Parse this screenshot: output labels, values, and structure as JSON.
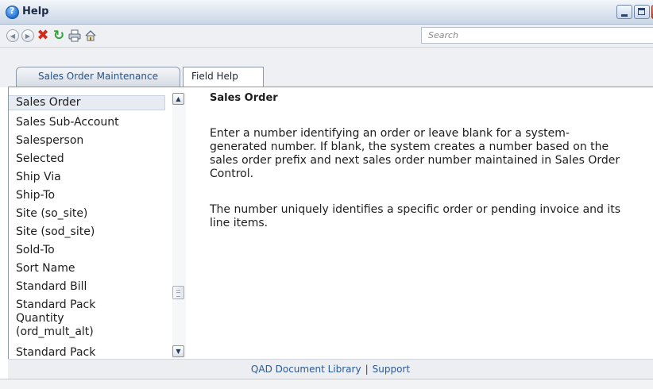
{
  "window": {
    "title": "Help"
  },
  "toolbar": {
    "icons": [
      "back-icon",
      "forward-icon",
      "stop-icon",
      "refresh-icon",
      "print-icon",
      "home-icon"
    ],
    "search_placeholder": "Search"
  },
  "tabs": [
    {
      "label": "Sales Order Maintenance",
      "active": false
    },
    {
      "label": "Field Help",
      "active": true
    }
  ],
  "list": {
    "items": [
      {
        "label": "Sales Order",
        "selected": true
      },
      {
        "label": "Sales Sub-Account"
      },
      {
        "label": "Salesperson"
      },
      {
        "label": "Selected"
      },
      {
        "label": "Ship Via"
      },
      {
        "label": "Ship-To"
      },
      {
        "label": "Site (so_site)"
      },
      {
        "label": "Site (sod_site)"
      },
      {
        "label": "Sold-To"
      },
      {
        "label": "Sort Name"
      },
      {
        "label": "Standard Bill"
      },
      {
        "label": "Standard Pack"
      },
      {
        "label": "Quantity"
      },
      {
        "label": "(ord_mult_alt)"
      },
      {
        "label": "Standard Pack"
      }
    ]
  },
  "content": {
    "title": "Sales Order",
    "para1": [
      "Enter a number identifying an order or leave blank for a system-",
      "generated number. If blank, the system creates a number based on the",
      "sales order prefix and next sales order number maintained in Sales Order",
      "Control."
    ],
    "para2": [
      "The number uniquely identifies a specific order or pending invoice and its",
      "line items."
    ]
  },
  "footer": {
    "library": "QAD Document Library",
    "separator": "|",
    "support": "Support"
  }
}
